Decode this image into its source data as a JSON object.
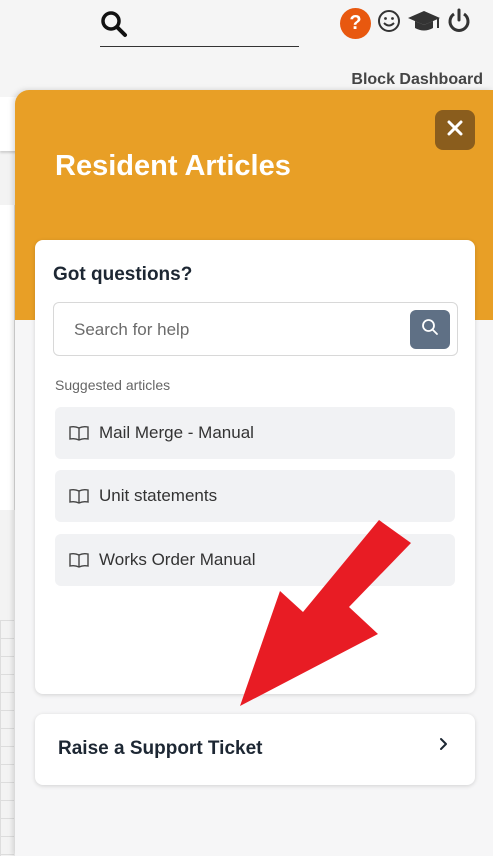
{
  "topbar": {
    "search_icon": "search-icon",
    "help_label": "?",
    "icons": [
      "help-icon",
      "smiley-icon",
      "graduation-cap-icon",
      "power-icon"
    ],
    "block_dashboard": "Block Dashboard"
  },
  "panel": {
    "title": "Resident Articles",
    "close_icon": "close-icon",
    "accent_color": "#e89f26",
    "card": {
      "title": "Got questions?",
      "search_placeholder": "Search for help",
      "suggested_label": "Suggested articles",
      "articles": [
        {
          "label": "Mail Merge - Manual",
          "icon": "book-icon"
        },
        {
          "label": "Unit statements",
          "icon": "book-icon"
        },
        {
          "label": "Works Order Manual",
          "icon": "book-icon"
        }
      ]
    },
    "ticket": {
      "label": "Raise a Support Ticket",
      "icon": "chevron-right-icon"
    }
  },
  "annotation": {
    "arrow_color": "#e81c24",
    "icon": "red-arrow-icon"
  }
}
